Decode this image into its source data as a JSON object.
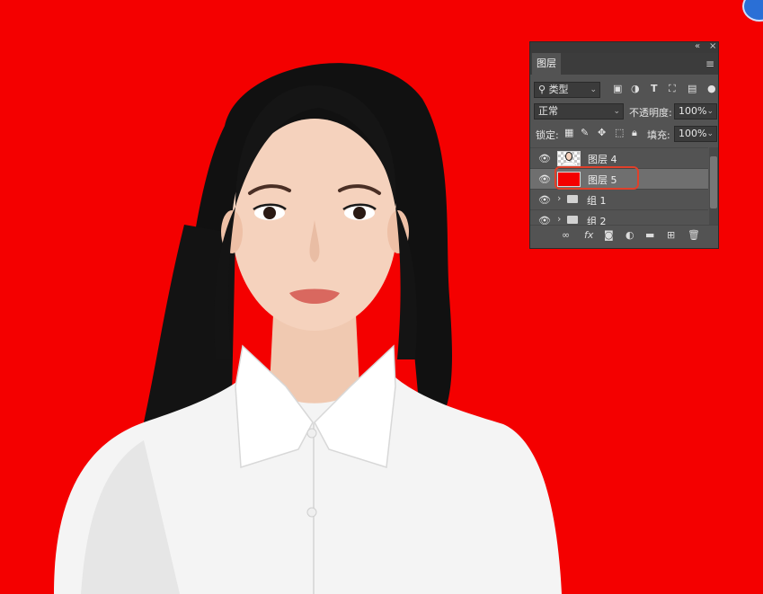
{
  "window": {
    "collapse_glyph": "«",
    "close_glyph": "×",
    "badge_icon": "app-badge-icon"
  },
  "panel": {
    "tab_label": "图层",
    "menu_icon": "menu-lines-icon",
    "filter": {
      "label": "类型",
      "icon": "search-icon"
    },
    "filter_icons": [
      "image-filter-icon",
      "adjustment-filter-icon",
      "type-filter-icon",
      "shape-filter-icon",
      "smart-object-filter-icon"
    ],
    "blend_mode": "正常",
    "opacity": {
      "label": "不透明度:",
      "value": "100%"
    },
    "lock": {
      "label": "锁定:",
      "icons": [
        "lock-transparent-icon",
        "lock-pixels-icon",
        "lock-position-icon",
        "lock-artboard-icon",
        "lock-all-icon"
      ]
    },
    "fill": {
      "label": "填充:",
      "value": "100%"
    },
    "layers": [
      {
        "type": "layer",
        "name": "图层 4",
        "visible": true,
        "selected": false,
        "thumbnail": "portrait-cutout"
      },
      {
        "type": "layer",
        "name": "图层 5",
        "visible": true,
        "selected": true,
        "thumbnail": "solid-red",
        "thumb_color": "#f40000"
      },
      {
        "type": "group",
        "name": "组 1",
        "visible": true,
        "selected": false,
        "collapsed": true
      },
      {
        "type": "group",
        "name": "组 2",
        "visible": true,
        "selected": false,
        "collapsed": true
      }
    ],
    "footer_icons": [
      "link-layers-icon",
      "fx-icon",
      "add-mask-icon",
      "adjustment-layer-icon",
      "new-group-icon",
      "new-layer-icon",
      "delete-icon"
    ],
    "footer_fx_label": "fx"
  },
  "canvas": {
    "background_color": "#f40000",
    "subject": "portrait-photo"
  },
  "colors": {
    "highlight": "#e0402a",
    "panel_bg": "#535353",
    "selected_row": "#6f6f6f"
  }
}
